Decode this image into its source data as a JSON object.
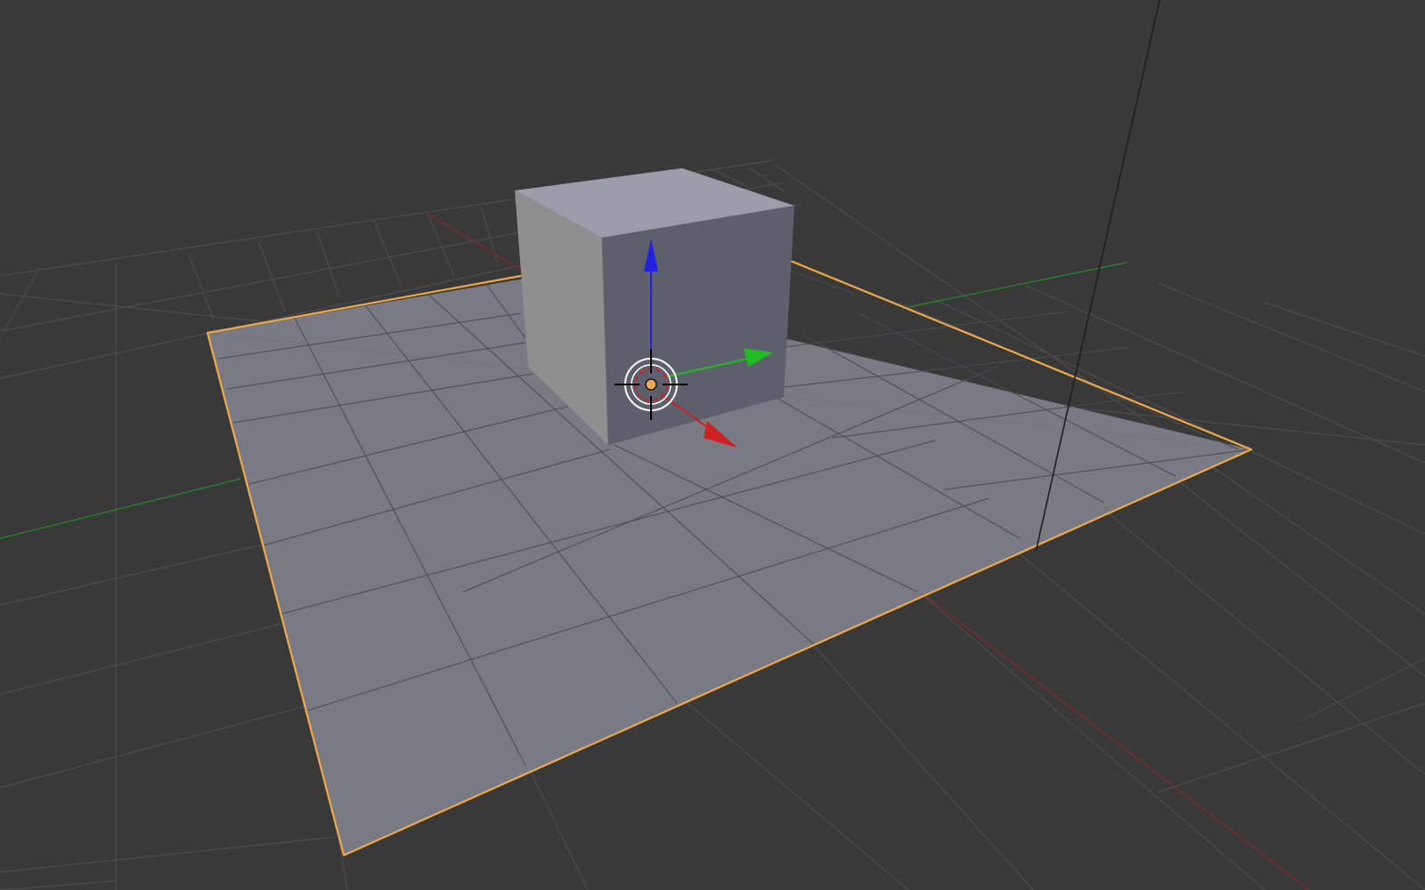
{
  "app": {
    "view": "3d-viewport",
    "shading": "solid"
  },
  "scene": {
    "objects": [
      {
        "name": "plane",
        "selected": true
      },
      {
        "name": "cube",
        "selected": false
      }
    ],
    "gizmo": {
      "type": "translate",
      "axes": [
        "x",
        "y",
        "z"
      ]
    },
    "cursor_3d": {
      "visible": true
    }
  },
  "colors": {
    "viewport_background": "#393939",
    "grid_line": "#4d4d4d",
    "plane_face": "#797a84",
    "plane_wire": "#4a4b52",
    "selection_outline": "#f0a848",
    "cube_top": "#9c9caa",
    "cube_left": "#8f8f8f",
    "cube_front": "#5e5f6c",
    "axis_x": "#cc2222",
    "axis_y": "#22bb22",
    "axis_z": "#2222dd",
    "origin_dot": "#f0a858"
  },
  "icons": {
    "cursor": "3d-cursor-icon",
    "origin": "object-origin-icon"
  }
}
